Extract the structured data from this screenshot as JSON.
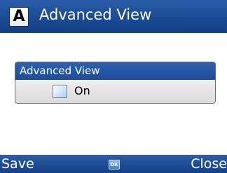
{
  "titlebar": {
    "icon_letter": "A",
    "icon": "app-letter-a-icon",
    "title": "Advanced View"
  },
  "group": {
    "header": "Advanced View",
    "option": {
      "label": "On",
      "checked": false
    }
  },
  "softkeys": {
    "left": "Save",
    "center": "OK",
    "right": "Close"
  },
  "colors": {
    "bar_blue": "#1d4e98",
    "background": "#ffffff",
    "row_gray": "#e4e4e4"
  }
}
